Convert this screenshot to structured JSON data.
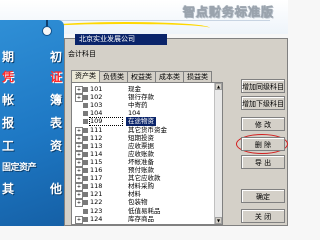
{
  "banner": {
    "title": "智点财务标准版"
  },
  "tag": {
    "rows": [
      {
        "a": "期",
        "b": "初",
        "hl": false
      },
      {
        "a": "凭",
        "b": "证",
        "hl": true
      },
      {
        "a": "帐",
        "b": "簿",
        "hl": false
      },
      {
        "a": "报",
        "b": "表",
        "hl": false
      },
      {
        "a": "工",
        "b": "资",
        "hl": false
      }
    ],
    "fixed_assets": "固定资产",
    "others": {
      "a": "其",
      "b": "他"
    }
  },
  "dialog": {
    "title": "会计科目",
    "company": "北京实业发展公司",
    "tabs": [
      "资产类",
      "负债类",
      "权益类",
      "成本类",
      "损益类"
    ],
    "active_tab": 0,
    "tree": [
      {
        "code": "101",
        "name": "现金",
        "exp": "+"
      },
      {
        "code": "102",
        "name": "银行存款",
        "exp": "+"
      },
      {
        "code": "103",
        "name": "中寄药",
        "exp": ""
      },
      {
        "code": "104",
        "name": "104",
        "exp": ""
      },
      {
        "code": "109",
        "name": "在途物资",
        "exp": "",
        "selected": true
      },
      {
        "code": "111",
        "name": "其它货币资金",
        "exp": "+"
      },
      {
        "code": "112",
        "name": "短期投资",
        "exp": "+"
      },
      {
        "code": "113",
        "name": "应收票据",
        "exp": "+"
      },
      {
        "code": "114",
        "name": "应收账款",
        "exp": "+"
      },
      {
        "code": "115",
        "name": "坏帐准备",
        "exp": "+"
      },
      {
        "code": "116",
        "name": "预付账款",
        "exp": "+"
      },
      {
        "code": "117",
        "name": "其它应收款",
        "exp": "+"
      },
      {
        "code": "118",
        "name": "材料采购",
        "exp": "+"
      },
      {
        "code": "121",
        "name": "材料",
        "exp": "+"
      },
      {
        "code": "122",
        "name": "包装物",
        "exp": "+"
      },
      {
        "code": "123",
        "name": "低值易耗品",
        "exp": ""
      },
      {
        "code": "124",
        "name": "库存商品",
        "exp": "+"
      }
    ],
    "buttons": {
      "add_same": "增加同级科目",
      "add_child": "增加下级科目",
      "modify": "修  改",
      "delete": "删  除",
      "export": "导  出",
      "ok": "确定",
      "close": "关  闭"
    }
  }
}
